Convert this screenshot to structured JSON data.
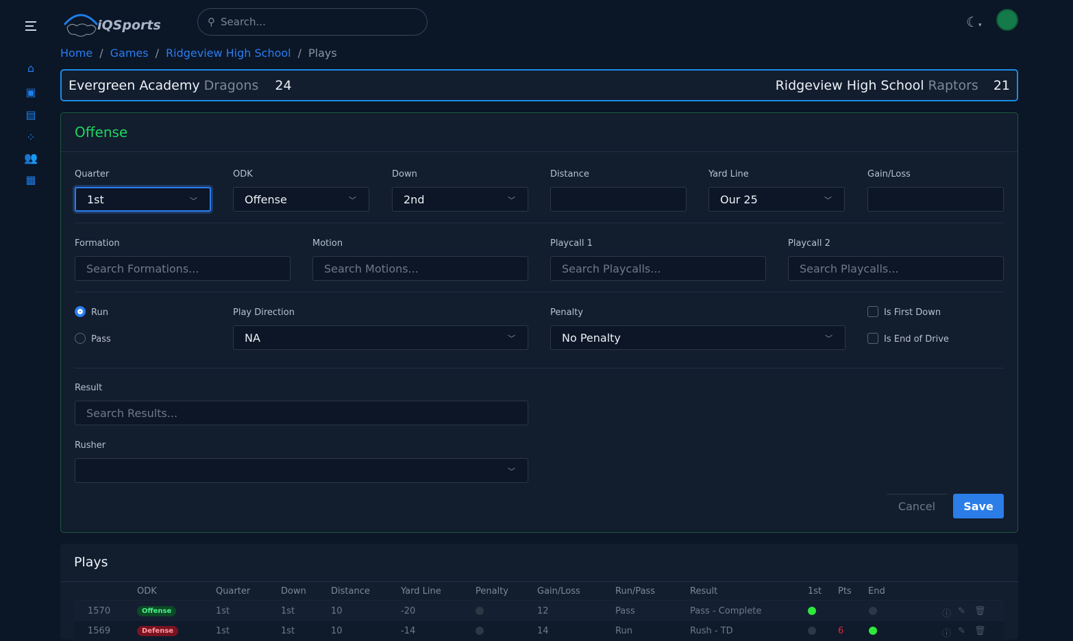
{
  "header": {
    "logo_text": "iQSports",
    "search_placeholder": "Search..."
  },
  "breadcrumb": [
    "Home",
    "Games",
    "Ridgeview High School",
    "Plays"
  ],
  "score": {
    "home_school": "Evergreen Academy",
    "home_mascot": "Dragons",
    "home_score": "24",
    "away_school": "Ridgeview High School",
    "away_mascot": "Raptors",
    "away_score": "21"
  },
  "form": {
    "title": "Offense",
    "quarter": {
      "label": "Quarter",
      "value": "1st"
    },
    "odk": {
      "label": "ODK",
      "value": "Offense"
    },
    "down": {
      "label": "Down",
      "value": "2nd"
    },
    "distance": {
      "label": "Distance",
      "value": ""
    },
    "yard_line": {
      "label": "Yard Line",
      "value": "Our 25"
    },
    "gain_loss": {
      "label": "Gain/Loss",
      "value": ""
    },
    "formation": {
      "label": "Formation",
      "placeholder": "Search Formations..."
    },
    "motion": {
      "label": "Motion",
      "placeholder": "Search Motions..."
    },
    "playcall1": {
      "label": "Playcall 1",
      "placeholder": "Search Playcalls..."
    },
    "playcall2": {
      "label": "Playcall 2",
      "placeholder": "Search Playcalls..."
    },
    "run_label": "Run",
    "pass_label": "Pass",
    "run_pass_selected": "Run",
    "play_direction": {
      "label": "Play Direction",
      "value": "NA"
    },
    "penalty": {
      "label": "Penalty",
      "value": "No Penalty"
    },
    "is_first_down": {
      "label": "Is First Down",
      "checked": false
    },
    "is_end_of_drive": {
      "label": "Is End of Drive",
      "checked": false
    },
    "result": {
      "label": "Result",
      "placeholder": "Search Results..."
    },
    "rusher": {
      "label": "Rusher",
      "value": ""
    },
    "cancel": "Cancel",
    "save": "Save"
  },
  "plays": {
    "title": "Plays",
    "columns": [
      "ODK",
      "Quarter",
      "Down",
      "Distance",
      "Yard Line",
      "Penalty",
      "Gain/Loss",
      "Run/Pass",
      "Result",
      "1st",
      "Pts",
      "End"
    ],
    "rows": [
      {
        "id": "1570",
        "odk": "Offense",
        "quarter": "1st",
        "down": "1st",
        "distance": "10",
        "yard_line": "-20",
        "penalty": false,
        "gain": "12",
        "run_pass": "Pass",
        "result": "Pass - Complete",
        "first": true,
        "pts": "",
        "end": false
      },
      {
        "id": "1569",
        "odk": "Defense",
        "quarter": "1st",
        "down": "1st",
        "distance": "10",
        "yard_line": "-14",
        "penalty": false,
        "gain": "14",
        "run_pass": "Run",
        "result": "Rush - TD",
        "first": false,
        "pts": "6",
        "end": true
      }
    ]
  },
  "colors": {
    "accent": "#2b7df0",
    "offense": "#1fd65f",
    "score_border": "#1a8ee6",
    "points": "#e0283c"
  }
}
